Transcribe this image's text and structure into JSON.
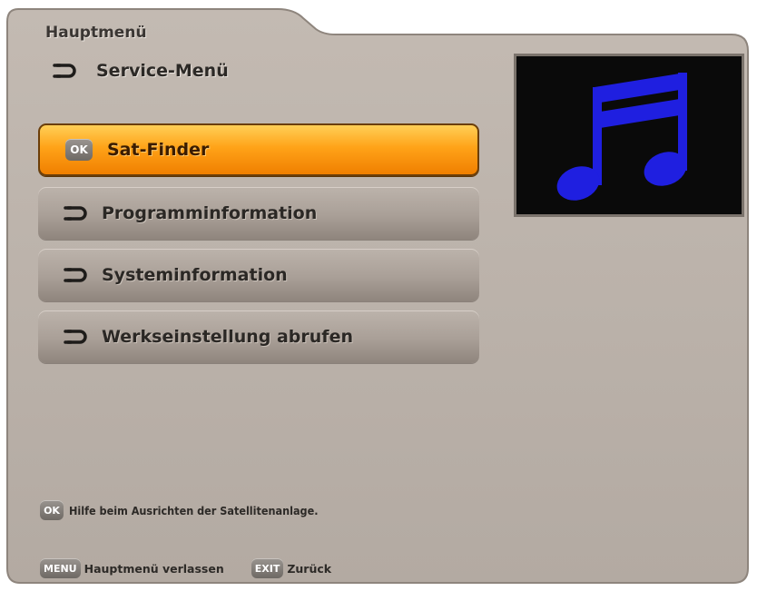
{
  "header": {
    "title": "Hauptmenü"
  },
  "submenu": {
    "label": "Service-Menü",
    "icon": "return-arrow-icon"
  },
  "menu": {
    "items": [
      {
        "label": "Sat-Finder",
        "badge": "OK",
        "selected": true
      },
      {
        "label": "Programminformation",
        "icon": "return-arrow-icon",
        "selected": false
      },
      {
        "label": "Systeminformation",
        "icon": "return-arrow-icon",
        "selected": false
      },
      {
        "label": "Werkseinstellung abrufen",
        "icon": "return-arrow-icon",
        "selected": false
      }
    ]
  },
  "preview": {
    "icon": "music-note-icon",
    "note_color": "#1f1fe0"
  },
  "hint": {
    "badge": "OK",
    "text": "Hilfe beim Ausrichten der Satellitenanlage."
  },
  "footer": {
    "menu_key": "MENU",
    "menu_text": "Hauptmenü verlassen",
    "exit_key": "EXIT",
    "exit_text": "Zurück"
  },
  "colors": {
    "panel": "#b9b0a8",
    "selected": "#ff9a10",
    "item": "#a79d95"
  }
}
